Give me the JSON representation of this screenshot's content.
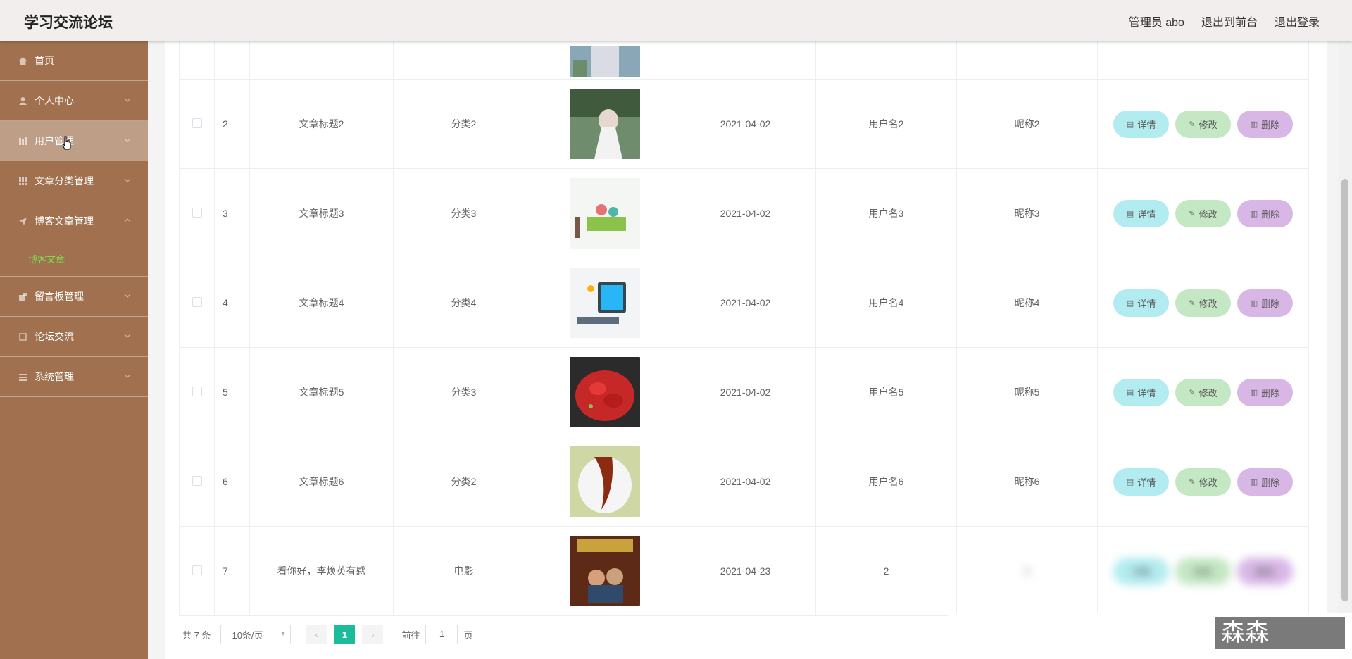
{
  "header": {
    "brand": "学习交流论坛",
    "admin": "管理员 abo",
    "to_front": "退出到前台",
    "logout": "退出登录"
  },
  "sidebar": {
    "items": [
      {
        "label": "首页",
        "icon": "home-icon"
      },
      {
        "label": "个人中心",
        "icon": "user-icon"
      },
      {
        "label": "用户管理",
        "icon": "users-icon"
      },
      {
        "label": "文章分类管理",
        "icon": "grid-icon"
      },
      {
        "label": "博客文章管理",
        "icon": "send-icon"
      },
      {
        "label": "留言板管理",
        "icon": "message-icon"
      },
      {
        "label": "论坛交流",
        "icon": "forum-icon"
      },
      {
        "label": "系统管理",
        "icon": "menu-icon"
      }
    ],
    "submenu": "博客文章"
  },
  "buttons": {
    "detail": "详情",
    "edit": "修改",
    "delete": "删除"
  },
  "rows": [
    {
      "id": "2",
      "title": "文章标题2",
      "category": "分类2",
      "date": "2021-04-02",
      "user": "用户名2",
      "nickname": "昵称2"
    },
    {
      "id": "3",
      "title": "文章标题3",
      "category": "分类3",
      "date": "2021-04-02",
      "user": "用户名3",
      "nickname": "昵称3"
    },
    {
      "id": "4",
      "title": "文章标题4",
      "category": "分类4",
      "date": "2021-04-02",
      "user": "用户名4",
      "nickname": "昵称4"
    },
    {
      "id": "5",
      "title": "文章标题5",
      "category": "分类3",
      "date": "2021-04-02",
      "user": "用户名5",
      "nickname": "昵称5"
    },
    {
      "id": "6",
      "title": "文章标题6",
      "category": "分类2",
      "date": "2021-04-02",
      "user": "用户名6",
      "nickname": "昵称6"
    },
    {
      "id": "7",
      "title": "看你好，李焕英有感",
      "category": "电影",
      "date": "2021-04-23",
      "user": "2",
      "nickname": "2"
    }
  ],
  "pagination": {
    "total": "共 7 条",
    "page_size": "10条/页",
    "current_page": "1",
    "goto_label": "前往",
    "goto_value": "1",
    "page_suffix": "页"
  },
  "watermark": "森森coding"
}
